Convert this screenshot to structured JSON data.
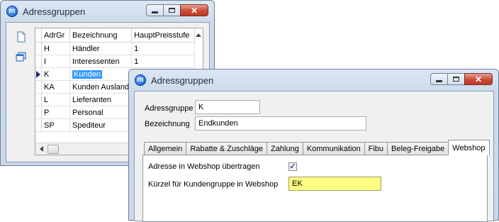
{
  "back_window": {
    "title": "Adressgruppen",
    "close_glyph": "✕",
    "grid": {
      "columns": [
        "AdrGr",
        "Bezeichnung",
        "HauptPreisstufe"
      ],
      "rows": [
        {
          "code": "H",
          "name": "Händler",
          "price": "1"
        },
        {
          "code": "I",
          "name": "Interessenten",
          "price": "1"
        },
        {
          "code": "K",
          "name": "Kunden",
          "price": ""
        },
        {
          "code": "KA",
          "name": "Kunden Ausland",
          "price": ""
        },
        {
          "code": "L",
          "name": "Lieferanten",
          "price": ""
        },
        {
          "code": "P",
          "name": "Personal",
          "price": ""
        },
        {
          "code": "SP",
          "name": "Spediteur",
          "price": ""
        }
      ],
      "selected_row": 2
    }
  },
  "front_window": {
    "title": "Adressgruppen",
    "close_glyph": "✕",
    "fields": {
      "adressgruppe_label": "Adressgruppe",
      "adressgruppe_value": "K",
      "bezeichnung_label": "Bezeichnung",
      "bezeichnung_value": "Endkunden"
    },
    "tabs": [
      "Allgemein",
      "Rabatte & Zuschläge",
      "Zahlung",
      "Kommunikation",
      "Fibu",
      "Beleg-Freigabe",
      "Webshop"
    ],
    "active_tab": "Webshop",
    "webshop": {
      "transfer_label": "Adresse in Webshop übertragen",
      "transfer_checked": true,
      "kuerzel_label": "Kürzel für Kundengruppe in Webshop",
      "kuerzel_value": "EK"
    }
  },
  "icons": {
    "app": "m-app-icon",
    "new_record": "new-document-icon",
    "copy_record": "copy-windows-icon",
    "row_indicator": "current-row-arrow-icon"
  },
  "colors": {
    "selection": "#3399ff",
    "highlight_field": "#ffff80",
    "close_button": "#c94a35"
  }
}
